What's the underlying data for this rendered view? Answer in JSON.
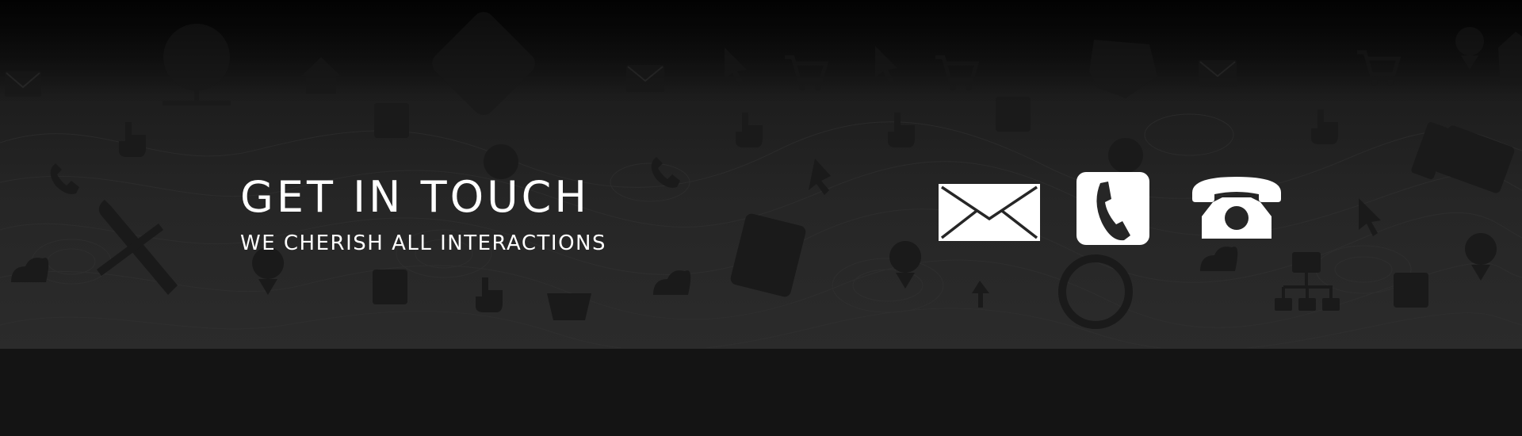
{
  "header": {
    "title": "GET IN TOUCH",
    "subtitle": "WE CHERISH ALL INTERACTIONS"
  },
  "contact_icons": [
    "mail-icon",
    "mobile-phone-icon",
    "landline-phone-icon"
  ],
  "background_icons": [
    "mail-icon",
    "globe-icon",
    "home-icon",
    "hand-pointer-icon",
    "plus-icon",
    "cart-icon",
    "cursor-icon",
    "phone-icon",
    "wrench-screwdriver-icon",
    "map-pin-icon",
    "calculator-icon",
    "basket-icon",
    "cloud-icon",
    "alarm-clock-icon",
    "sitemap-icon",
    "monitor-icon"
  ],
  "colors": {
    "text": "#ffffff",
    "background_top": "#050505",
    "background_bottom": "#2b2b2b",
    "bottom_band": "#141414",
    "pattern_icon": "#1a1a1a"
  }
}
